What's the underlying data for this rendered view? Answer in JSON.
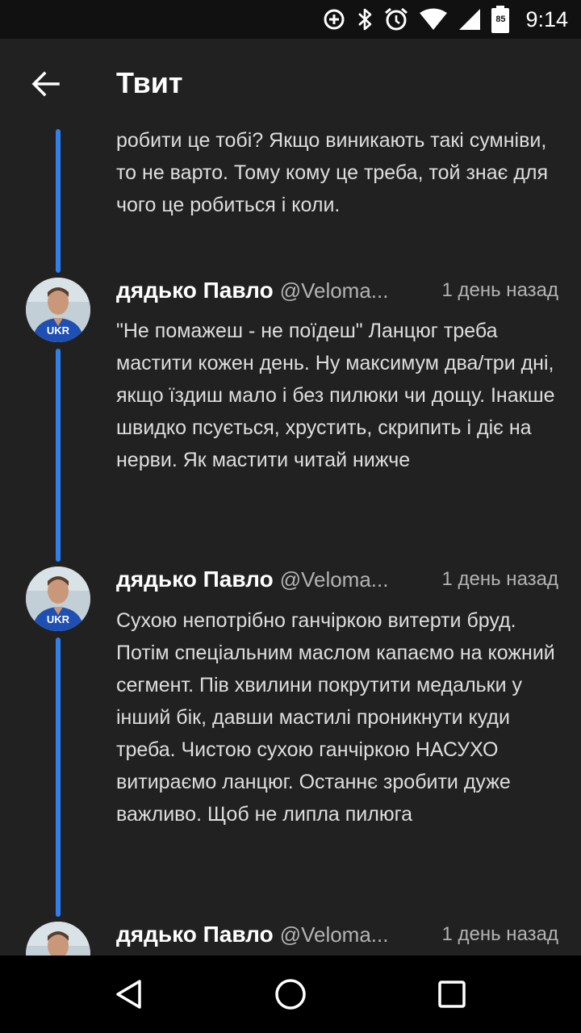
{
  "status_bar": {
    "time": "9:14",
    "battery_level": "85",
    "icons": [
      "data-saver-icon",
      "bluetooth-icon",
      "alarm-icon",
      "wifi-icon",
      "signal-icon",
      "battery-icon"
    ]
  },
  "header": {
    "title": "Твит",
    "back_icon": "arrow-back-icon"
  },
  "thread": {
    "partial_tweet": {
      "text": "робити це тобі? Якщо виникають такі сумніви, то не варто. Тому кому це треба, той знає для чого це робиться і коли."
    },
    "tweets": [
      {
        "author": "дядько Павло",
        "handle": "@Veloma...",
        "time": "1 день назад",
        "text": "\"Не помажеш - не поїдеш\" Ланцюг треба мастити кожен день. Ну максимум два/три дні, якщо їздиш мало і без пилюки чи дощу. Інакше швидко псується, хрустить, скрипить і діє на нерви. Як мастити читай нижче"
      },
      {
        "author": "дядько Павло",
        "handle": "@Veloma...",
        "time": "1 день назад",
        "text": "Сухою непотрібно ганчіркою витерти бруд. Потім спеціальним маслом капаємо на кожний сегмент. Пів хвилини покрутити медальки у інший бік, давши мастилі проникнути куди треба. Чистою сухою ганчіркою НАСУХО витираємо ланцюг. Останнє зробити дуже важливо. Щоб не липла пилюга"
      },
      {
        "author": "дядько Павло",
        "handle": "@Veloma...",
        "time": "1 день назад",
        "text": ""
      }
    ],
    "avatar_jersey_text": "UKR",
    "thread_line_color": "#2f80ed"
  },
  "nav_bar": {
    "icons": [
      "back-triangle-icon",
      "home-circle-icon",
      "recents-square-icon"
    ]
  }
}
